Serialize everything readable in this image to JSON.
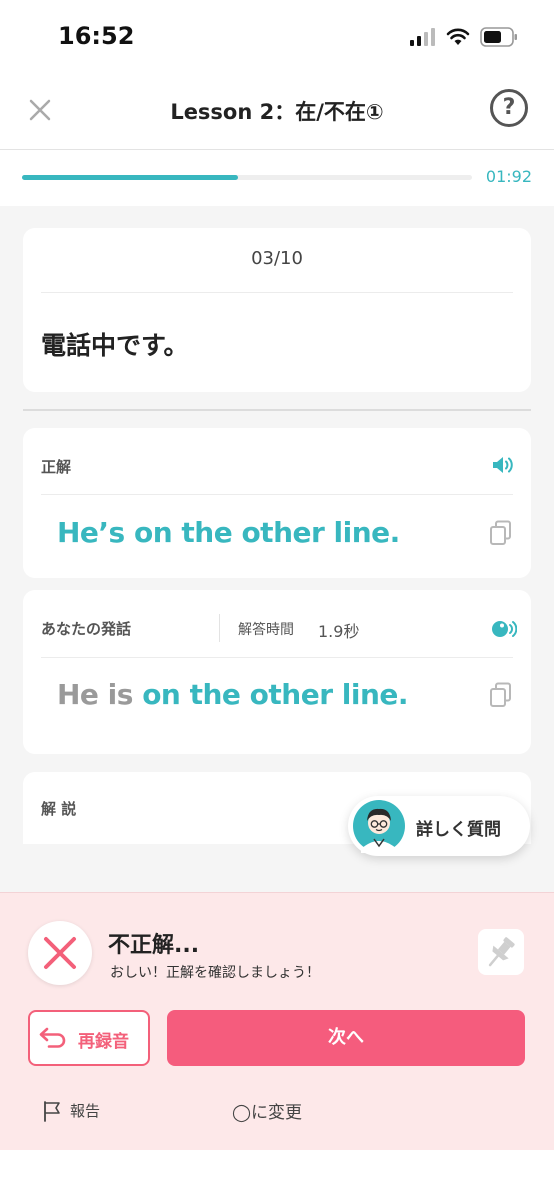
{
  "status_bar": {
    "time": "16:52"
  },
  "header": {
    "title": "Lesson 2：在/不在①",
    "help_label": "?"
  },
  "progress": {
    "fraction": 0.48,
    "timer": "01:92"
  },
  "question": {
    "counter": "03/10",
    "text": "電話中です。"
  },
  "correct_answer": {
    "label": "正解",
    "text": "He’s on the other line."
  },
  "your_speech": {
    "label": "あなたの発話",
    "time_label": "解答時間",
    "time_value": "1.9秒",
    "wrong_part": "He is ",
    "correct_part": "on the other line."
  },
  "explanation": {
    "label": "解 説"
  },
  "ask_button": {
    "label": "詳しく質問"
  },
  "result": {
    "title": "不正解...",
    "subtitle": "おしい！正解を確認しましょう！"
  },
  "actions": {
    "rerecord_label": "再録音",
    "next_label": "次へ"
  },
  "footer": {
    "report_label": "報告",
    "change_label": "◯に変更"
  },
  "colors": {
    "accent": "#38b7bf",
    "error": "#f3607a",
    "next_button": "#f55c7d",
    "panel_bg": "#fde8e9"
  }
}
